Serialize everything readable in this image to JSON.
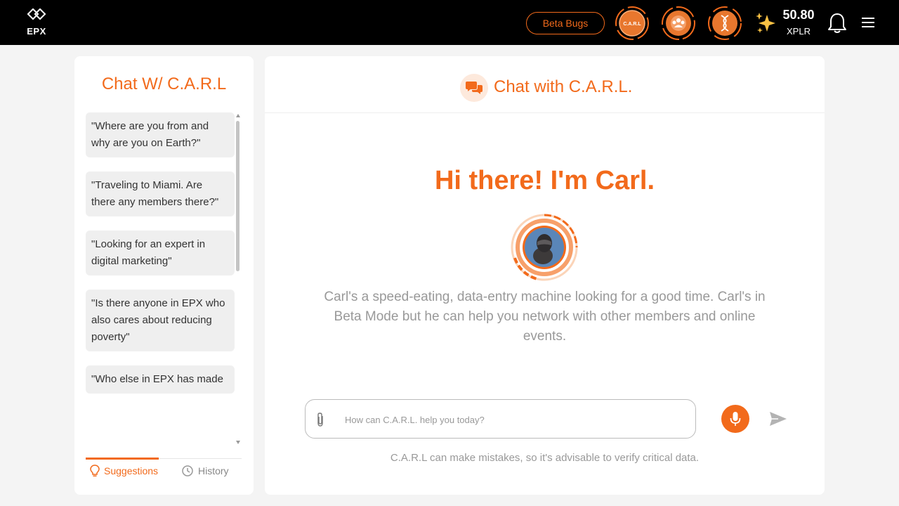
{
  "header": {
    "logo_text": "EPX",
    "beta_button": "Beta Bugs",
    "badges": [
      "carl-badge",
      "community-badge",
      "dna-badge"
    ],
    "carl_badge_text": "C.A.R.L",
    "xplr_value": "50.80",
    "xplr_unit": "XPLR"
  },
  "sidebar": {
    "title": "Chat W/ C.A.R.L",
    "suggestions": [
      "\"Where are you from and why are you on Earth?\"",
      "\"Traveling to Miami. Are there any members there?\"",
      "\"Looking for an expert in digital marketing\"",
      "\"Is there anyone in EPX who also cares about reducing poverty\"",
      "\"Who else in EPX has made"
    ],
    "tabs": {
      "suggestions": "Suggestions",
      "history": "History"
    }
  },
  "main": {
    "header_title": "Chat with C.A.R.L.",
    "greeting": "Hi there! I'm Carl.",
    "description": "Carl's a speed-eating, data-entry machine looking for a good time. Carl's in Beta Mode but he can help you network with other members and online events.",
    "input_placeholder": "How can C.A.R.L. help you today?",
    "disclaimer": "C.A.R.L can make mistakes, so it's advisable to verify critical data."
  },
  "colors": {
    "accent": "#f26a1b",
    "topbar": "#000000",
    "background": "#f4f4f4"
  }
}
